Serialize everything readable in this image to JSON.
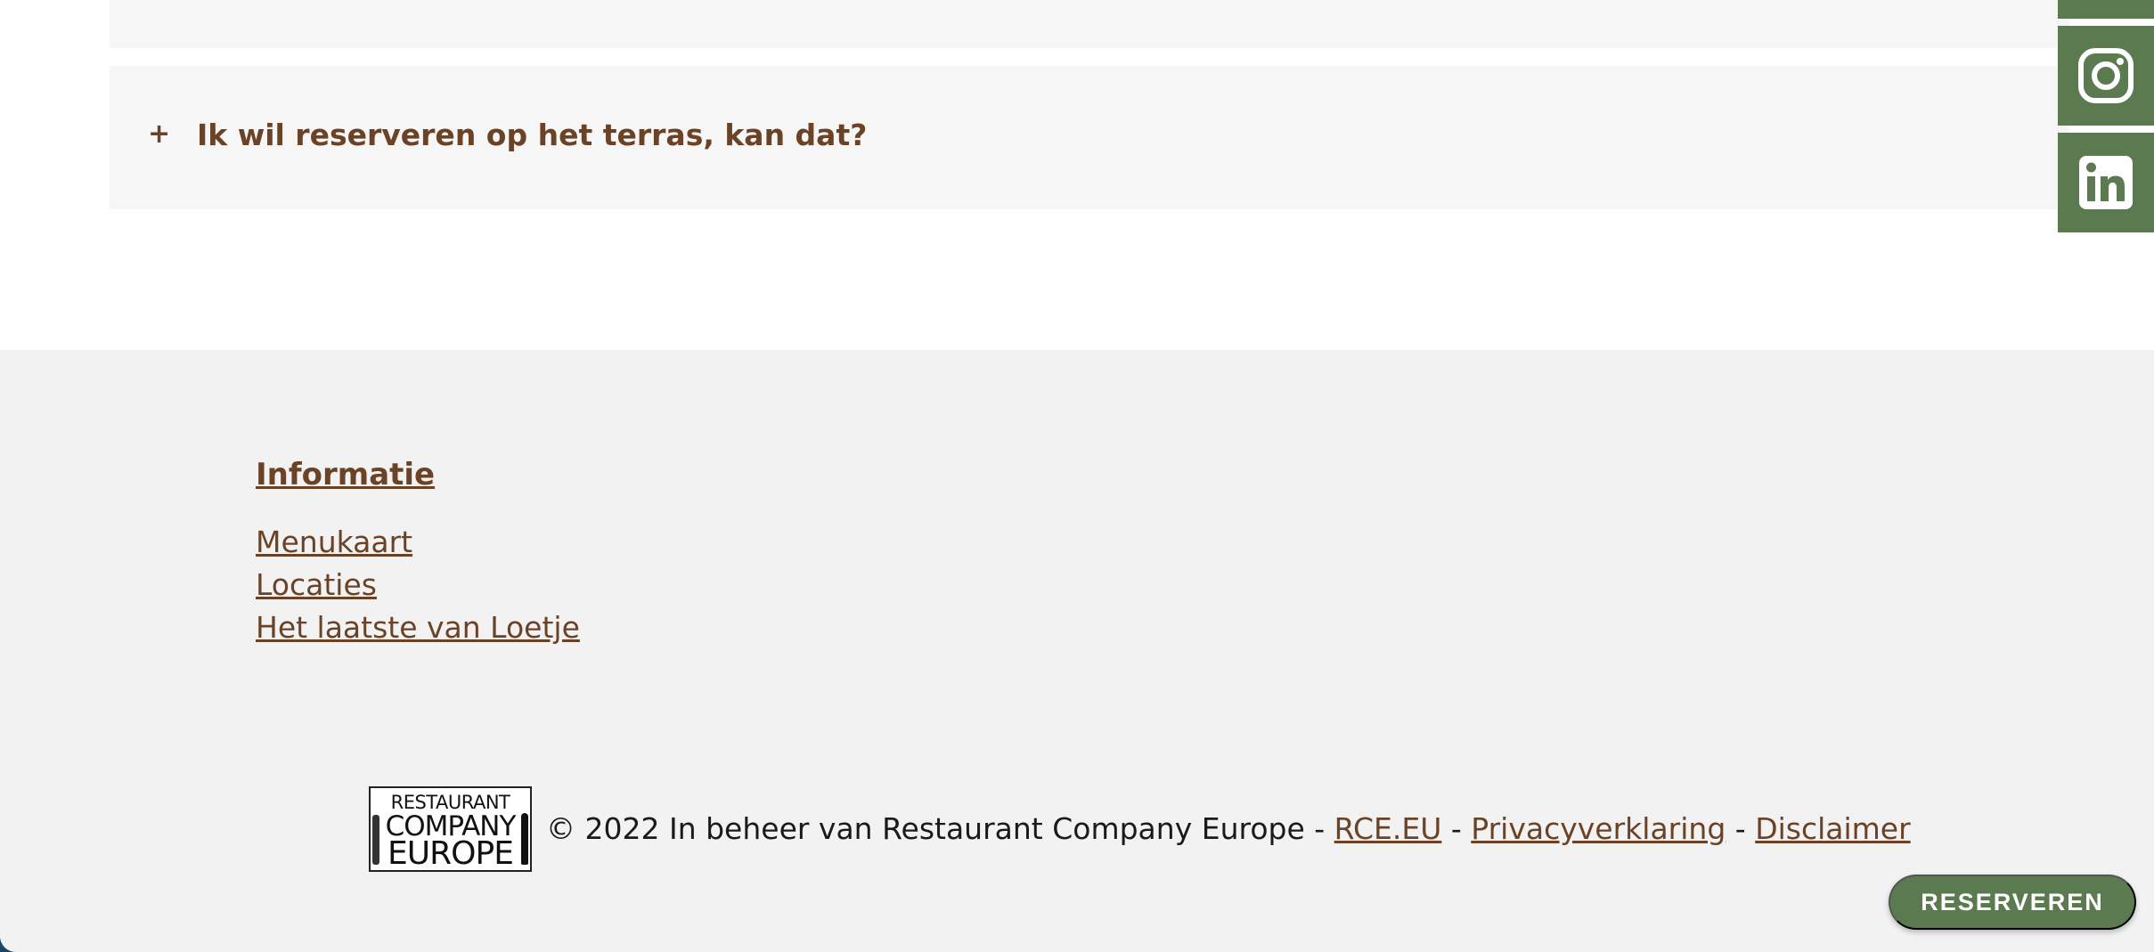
{
  "faq": {
    "toggle_symbol": "+",
    "question": "Ik wil reserveren op het terras, kan dat?"
  },
  "social": {
    "icons": [
      "instagram-icon",
      "linkedin-icon"
    ]
  },
  "footer": {
    "info_heading": "Informatie",
    "links": [
      "Menukaart",
      "Locaties",
      "Het laatste van Loetje"
    ],
    "logo": {
      "line1": "RESTAURANT",
      "line2": "COMPANY",
      "line3": "EUROPE"
    },
    "copyright": "© 2022 In beheer van Restaurant Company Europe -",
    "sep": "-",
    "link_rce": "RCE.EU",
    "link_privacy": "Privacyverklaring",
    "link_disclaimer": "Disclaimer"
  },
  "reserve_button": "RESERVEREN",
  "colors": {
    "brand_brown": "#6b4226",
    "brand_green": "#5c7a50",
    "footer_bg": "#f2f2f2",
    "accordion_bg": "#f6f6f6"
  }
}
